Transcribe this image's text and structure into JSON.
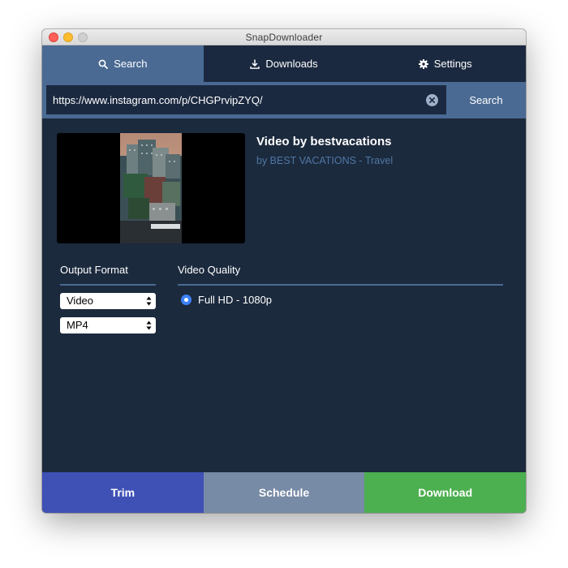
{
  "window": {
    "title": "SnapDownloader"
  },
  "tabs": [
    {
      "label": "Search",
      "icon": "search-icon",
      "active": true
    },
    {
      "label": "Downloads",
      "icon": "download-icon",
      "active": false
    },
    {
      "label": "Settings",
      "icon": "gear-icon",
      "active": false
    }
  ],
  "search": {
    "url": "https://www.instagram.com/p/CHGPrvipZYQ/",
    "button_label": "Search"
  },
  "video": {
    "title": "Video by bestvacations",
    "author": "by BEST VACATIONS - Travel"
  },
  "output_format": {
    "label": "Output Format",
    "type_value": "Video",
    "container_value": "MP4"
  },
  "video_quality": {
    "label": "Video Quality",
    "selected": "Full HD - 1080p"
  },
  "actions": {
    "trim": "Trim",
    "schedule": "Schedule",
    "download": "Download"
  },
  "colors": {
    "background": "#1c2a3e",
    "tab_active": "#4a6a93",
    "trim": "#3f51b5",
    "schedule": "#788ba6",
    "download": "#4caf50",
    "author_link": "#4f77a3",
    "radio": "#3b82f6"
  }
}
